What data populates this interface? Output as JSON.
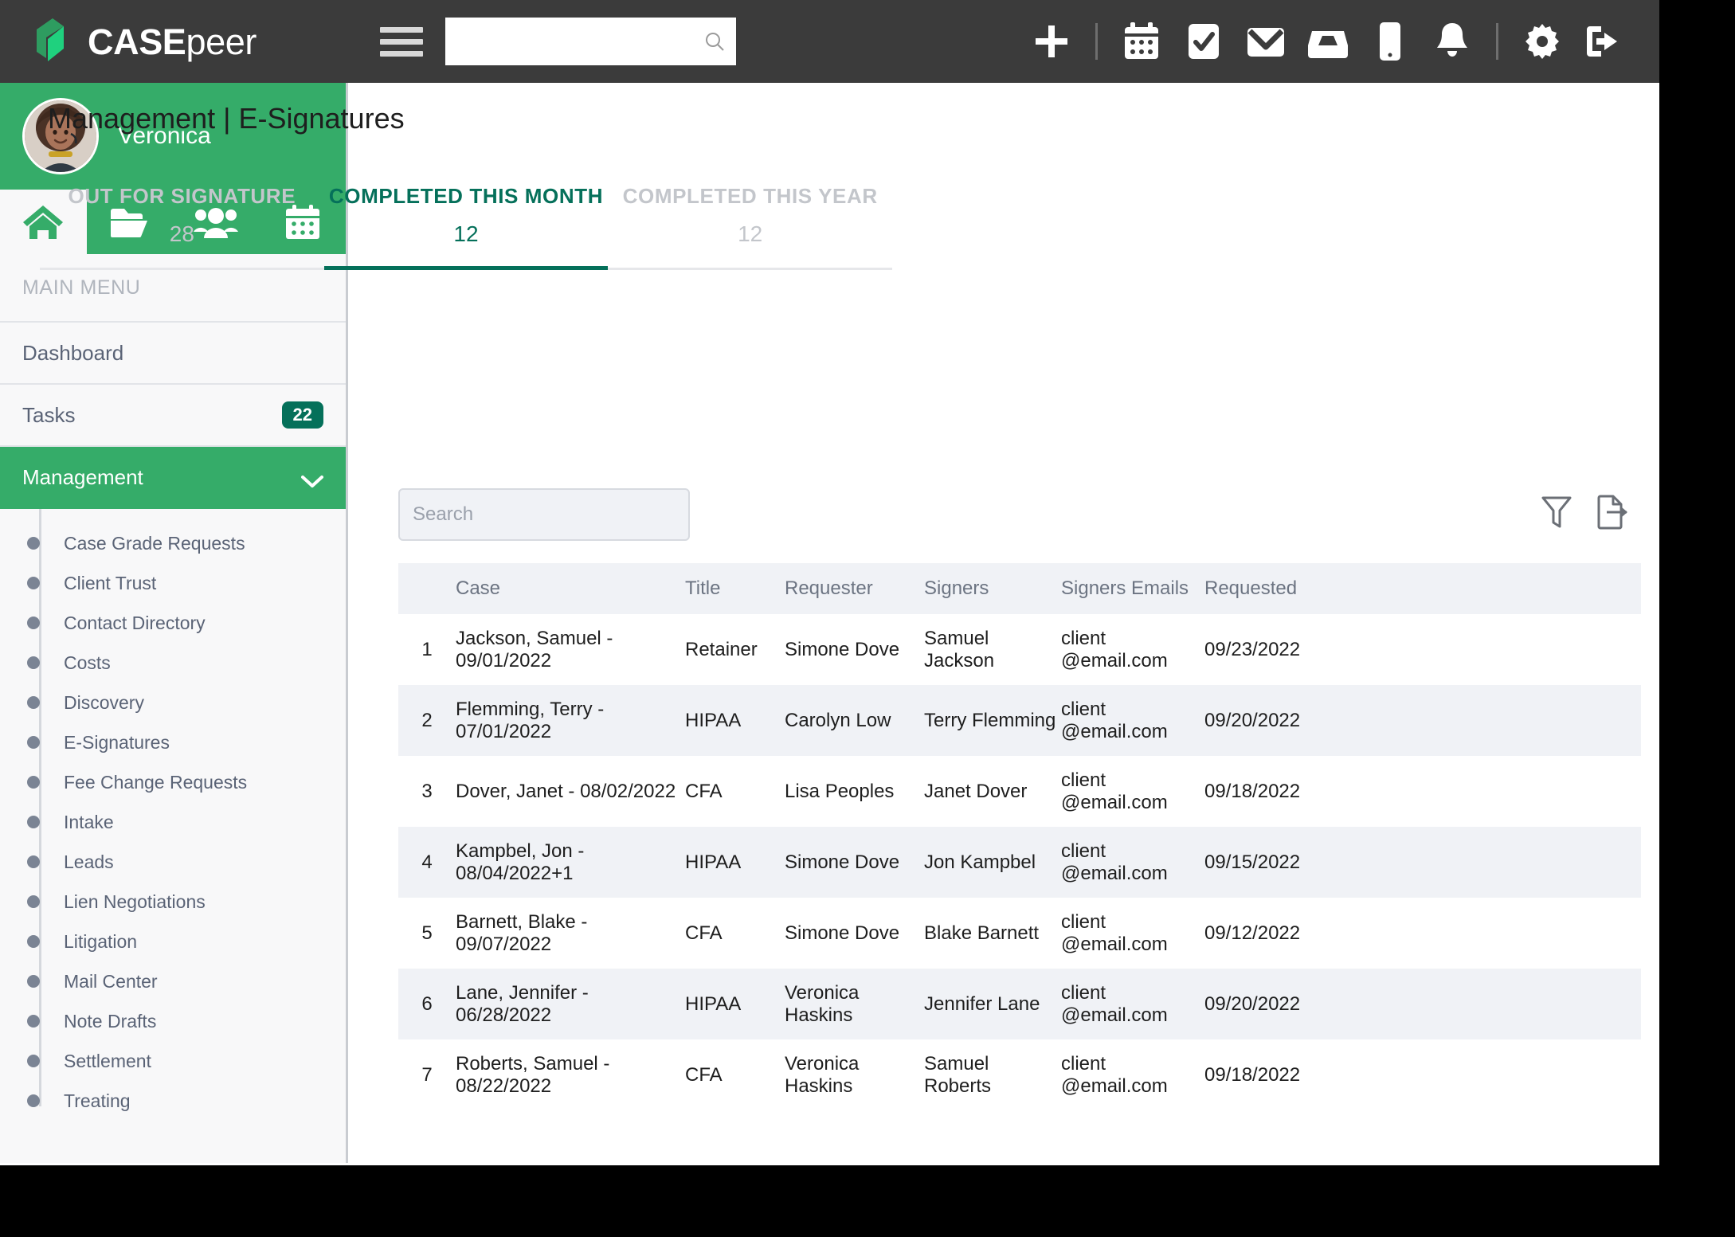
{
  "brand": {
    "name_bold": "CASE",
    "name_light": "peer"
  },
  "topnav": {
    "search_placeholder": "",
    "search_value": "",
    "icons": [
      {
        "name": "add-icon",
        "label": "Add"
      },
      {
        "name": "calendar-icon",
        "label": "Calendar"
      },
      {
        "name": "tasks-icon",
        "label": "Tasks"
      },
      {
        "name": "mail-icon",
        "label": "Mail"
      },
      {
        "name": "inbox-icon",
        "label": "Inbox"
      },
      {
        "name": "mobile-icon",
        "label": "Mobile"
      },
      {
        "name": "notifications-icon",
        "label": "Notifications"
      },
      {
        "name": "settings-icon",
        "label": "Settings"
      },
      {
        "name": "logout-icon",
        "label": "Log out"
      }
    ]
  },
  "sidebar": {
    "user_name": "Veronica",
    "nav_tabs": [
      {
        "name": "home-icon",
        "label": "Home",
        "active": true
      },
      {
        "name": "folder-icon",
        "label": "Cases",
        "active": false
      },
      {
        "name": "people-icon",
        "label": "Contacts",
        "active": false
      },
      {
        "name": "calendar-icon",
        "label": "Calendar",
        "active": false
      }
    ],
    "section_label": "MAIN MENU",
    "items": [
      {
        "label": "Dashboard",
        "badge": "",
        "active": false
      },
      {
        "label": "Tasks",
        "badge": "22",
        "active": false
      },
      {
        "label": "Management",
        "badge": "",
        "active": true
      }
    ],
    "submenu": [
      "Case Grade Requests",
      "Client Trust",
      "Contact Directory",
      "Costs",
      "Discovery",
      "E-Signatures",
      "Fee Change Requests",
      "Intake",
      "Leads",
      "Lien Negotiations",
      "Litigation",
      "Mail Center",
      "Note Drafts",
      "Settlement",
      "Treating"
    ]
  },
  "main": {
    "page_title": "Management | E-Signatures",
    "tabs": [
      {
        "label": "OUT FOR SIGNATURE",
        "count": "28",
        "active": false
      },
      {
        "label": "COMPLETED THIS MONTH",
        "count": "12",
        "active": true
      },
      {
        "label": "COMPLETED THIS YEAR",
        "count": "12",
        "active": false
      }
    ],
    "search_placeholder": "Search",
    "search_value": "",
    "toolbar_icons": [
      {
        "name": "filter-icon",
        "label": "Filter"
      },
      {
        "name": "export-icon",
        "label": "Export"
      }
    ],
    "table": {
      "columns": [
        "",
        "Case",
        "Title",
        "Requester",
        "Signers",
        "Signers Emails",
        "Requested"
      ],
      "rows": [
        {
          "num": "1",
          "case": "Jackson, Samuel - 09/01/2022",
          "title": "Retainer",
          "requester": "Simone Dove",
          "signers": "Samuel Jackson",
          "emails": "client @email.com",
          "requested": "09/23/2022"
        },
        {
          "num": "2",
          "case": "Flemming, Terry - 07/01/2022",
          "title": "HIPAA",
          "requester": "Carolyn Low",
          "signers": "Terry Flemming",
          "emails": "client @email.com",
          "requested": "09/20/2022"
        },
        {
          "num": "3",
          "case": "Dover, Janet - 08/02/2022",
          "title": "CFA",
          "requester": "Lisa Peoples",
          "signers": "Janet Dover",
          "emails": "client @email.com",
          "requested": "09/18/2022"
        },
        {
          "num": "4",
          "case": "Kampbel, Jon - 08/04/2022+1",
          "title": "HIPAA",
          "requester": "Simone Dove",
          "signers": "Jon Kampbel",
          "emails": "client @email.com",
          "requested": "09/15/2022"
        },
        {
          "num": "5",
          "case": "Barnett, Blake - 09/07/2022",
          "title": "CFA",
          "requester": "Simone Dove",
          "signers": "Blake Barnett",
          "emails": "client @email.com",
          "requested": "09/12/2022"
        },
        {
          "num": "6",
          "case": "Lane, Jennifer - 06/28/2022",
          "title": "HIPAA",
          "requester": "Veronica Haskins",
          "signers": "Jennifer Lane",
          "emails": "client @email.com",
          "requested": "09/20/2022"
        },
        {
          "num": "7",
          "case": "Roberts, Samuel - 08/22/2022",
          "title": "CFA",
          "requester": "Veronica Haskins",
          "signers": "Samuel Roberts",
          "emails": "client @email.com",
          "requested": "09/18/2022"
        }
      ]
    }
  },
  "colors": {
    "brand_green": "#35ac69",
    "accent_teal": "#05705a",
    "topnav_bg": "#3b3b3b",
    "row_alt": "#f0f2f6"
  }
}
